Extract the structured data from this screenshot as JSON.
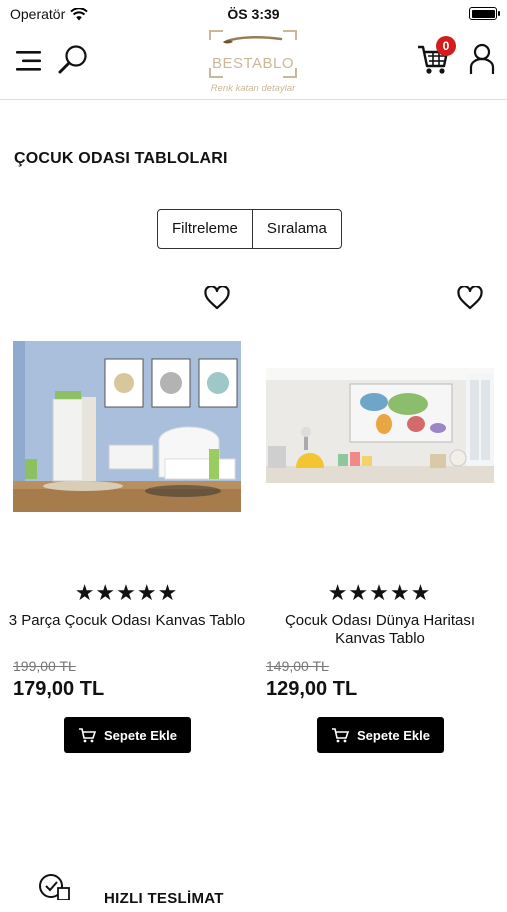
{
  "status_bar": {
    "carrier": "Operatör",
    "time": "ÖS 3:39"
  },
  "header": {
    "logo_text": "BESTABLO",
    "logo_tagline": "Renk katan detaylar",
    "cart_count": "0"
  },
  "page": {
    "title": "ÇOCUK ODASI TABLOLARI"
  },
  "toolbar": {
    "filter_label": "Filtreleme",
    "sort_label": "Sıralama"
  },
  "products": [
    {
      "name": "3 Parça Çocuk Odası Kanvas Tablo",
      "stars": "★★★★★",
      "rating": 5,
      "old_price": "199,00 TL",
      "price": "179,00 TL",
      "button": "Sepete Ekle"
    },
    {
      "name": "Çocuk Odası Dünya Haritası Kanvas Tablo",
      "stars": "★★★★★",
      "rating": 5,
      "old_price": "149,00 TL",
      "price": "129,00 TL",
      "button": "Sepete Ekle"
    }
  ],
  "features": {
    "delivery_label": "HIZLI TESLİMAT"
  },
  "colors": {
    "badge": "#d31d1d",
    "button": "#000000",
    "logo": "#c9b89a"
  }
}
